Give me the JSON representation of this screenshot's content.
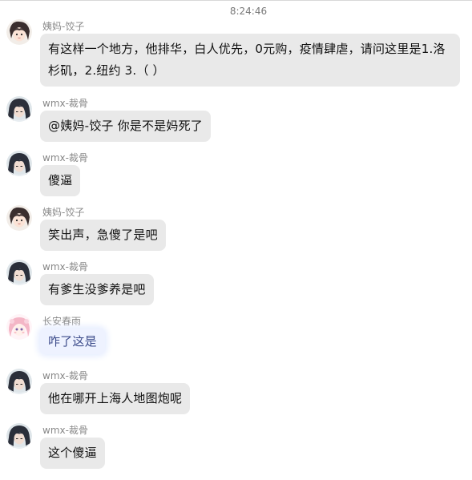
{
  "chat": {
    "timestamp": "8:24:46",
    "messages": [
      {
        "sender": "姨妈-饺子",
        "avatar_icon": "anime-girl-avatar-icon",
        "text": "有这样一个地方，他排华，白人优先，0元购，疫情肆虐，请问这里是1.洛杉矶，2.纽约  3.（ ）"
      },
      {
        "sender": "wmx-裁骨",
        "avatar_icon": "anime-character-avatar-icon",
        "text": "@姨妈-饺子 你是不是妈死了"
      },
      {
        "sender": "wmx-裁骨",
        "avatar_icon": "anime-character-avatar-icon",
        "text": "傻逼"
      },
      {
        "sender": "姨妈-饺子",
        "avatar_icon": "anime-girl-avatar-icon",
        "text": "笑出声，急傻了是吧"
      },
      {
        "sender": "wmx-裁骨",
        "avatar_icon": "anime-character-avatar-icon",
        "text": "有爹生没爹养是吧"
      },
      {
        "sender": "长安春雨",
        "avatar_icon": "pink-anime-avatar-icon",
        "text": "咋了这是"
      },
      {
        "sender": "wmx-裁骨",
        "avatar_icon": "anime-character-avatar-icon",
        "text": "他在哪开上海人地图炮呢"
      },
      {
        "sender": "wmx-裁骨",
        "avatar_icon": "anime-character-avatar-icon",
        "text": "这个傻逼"
      }
    ]
  },
  "colors": {
    "bubble": "#e9e9e9",
    "special_bubble": "#eef2ff",
    "sender_text": "#888888",
    "timestamp_text": "#777777"
  }
}
